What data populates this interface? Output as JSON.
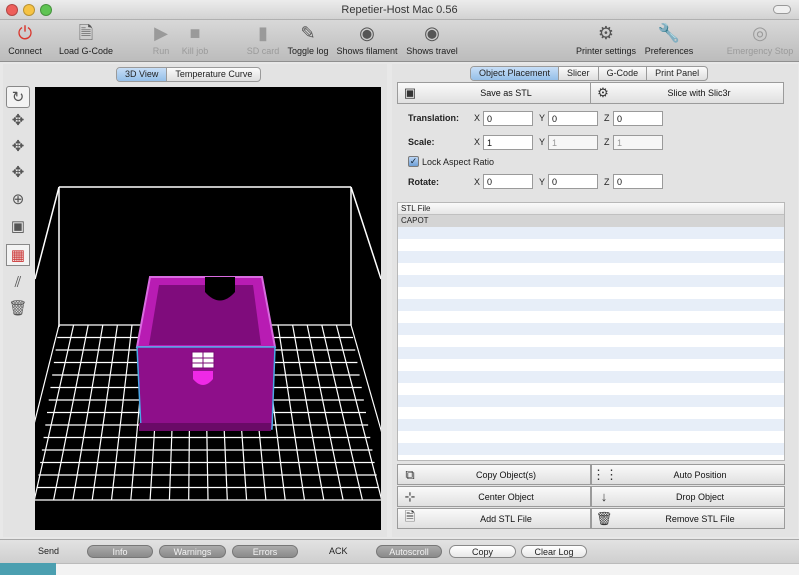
{
  "window": {
    "title": "Repetier-Host Mac 0.56",
    "traffic_colors": [
      "#ee5f5b",
      "#f6c343",
      "#5fc453"
    ]
  },
  "toolbar": {
    "items": [
      {
        "label": "Connect",
        "icon": "power-icon",
        "glyph": "⏻",
        "enabled": true,
        "color": "#d9382e"
      },
      {
        "label": "Load G-Code",
        "icon": "document-icon",
        "glyph": "🗎",
        "enabled": true
      },
      {
        "label": "Run",
        "icon": "play-icon",
        "glyph": "▶",
        "enabled": false
      },
      {
        "label": "Kill job",
        "icon": "stop-icon",
        "glyph": "■",
        "enabled": false
      },
      {
        "label": "SD card",
        "icon": "sd-card-icon",
        "glyph": "▮",
        "enabled": false
      },
      {
        "label": "Toggle log",
        "icon": "pencil-icon",
        "glyph": "✎",
        "enabled": true
      },
      {
        "label": "Shows filament",
        "icon": "eye-icon",
        "glyph": "◉",
        "enabled": true
      },
      {
        "label": "Shows travel",
        "icon": "eye-icon",
        "glyph": "◉",
        "enabled": true
      },
      {
        "label": "Printer settings",
        "icon": "gears-icon",
        "glyph": "⚙",
        "enabled": true
      },
      {
        "label": "Preferences",
        "icon": "wrench-icon",
        "glyph": "🔧",
        "enabled": true
      },
      {
        "label": "Emergency Stop",
        "icon": "emergency-icon",
        "glyph": "◎",
        "enabled": false
      }
    ]
  },
  "left_tabs": [
    "3D View",
    "Temperature Curve"
  ],
  "left_active_tab": 0,
  "side_tools": [
    {
      "icon": "reset-view-icon",
      "glyph": "↻"
    },
    {
      "icon": "camera-move-icon",
      "glyph": "✥"
    },
    {
      "icon": "move-icon",
      "glyph": "✥"
    },
    {
      "icon": "move-object-icon",
      "glyph": "✥"
    },
    {
      "icon": "zoom-icon",
      "glyph": "⊕"
    },
    {
      "icon": "view-box-icon",
      "glyph": "▣"
    },
    {
      "icon": "grid-icon",
      "glyph": "▦"
    },
    {
      "icon": "parallel-lines-icon",
      "glyph": "⫽"
    },
    {
      "icon": "trash-icon",
      "glyph": "🗑"
    }
  ],
  "right_tabs": [
    "Object Placement",
    "Slicer",
    "G-Code",
    "Print Panel"
  ],
  "right_active_tab": 0,
  "actions": {
    "save_stl": "Save as STL",
    "slice": "Slice with Slic3r"
  },
  "placement": {
    "translation_label": "Translation:",
    "scale_label": "Scale:",
    "rotate_label": "Rotate:",
    "lock_label": "Lock Aspect Ratio",
    "lock_checked": true,
    "axes": [
      "X",
      "Y",
      "Z"
    ],
    "translation": [
      "0",
      "0",
      "0"
    ],
    "scale": [
      "1",
      "1",
      "1"
    ],
    "rotate": [
      "0",
      "0",
      "0"
    ]
  },
  "file_list": {
    "header": "STL File",
    "files": [
      "CAPOT"
    ]
  },
  "object_buttons": [
    {
      "label": "Copy Object(s)",
      "icon": "copy-icon",
      "glyph": "⧉"
    },
    {
      "label": "Auto Position",
      "icon": "auto-position-icon",
      "glyph": "⋮⋮"
    },
    {
      "label": "Center Object",
      "icon": "center-icon",
      "glyph": "⊹"
    },
    {
      "label": "Drop Object",
      "icon": "arrow-down-icon",
      "glyph": "↓"
    },
    {
      "label": "Add STL File",
      "icon": "add-file-icon",
      "glyph": "🗎"
    },
    {
      "label": "Remove STL File",
      "icon": "trash-icon",
      "glyph": "🗑"
    }
  ],
  "log_bar": {
    "send": "Send",
    "info": "Info",
    "warnings": "Warnings",
    "errors": "Errors",
    "ack": "ACK",
    "autoscroll": "Autoscroll",
    "copy": "Copy",
    "clear_log": "Clear Log"
  },
  "colors": {
    "model": "#8e0f8a",
    "model_highlight": "#e020d8",
    "grid": "#ffffff",
    "progress": "#4b9fb0"
  }
}
